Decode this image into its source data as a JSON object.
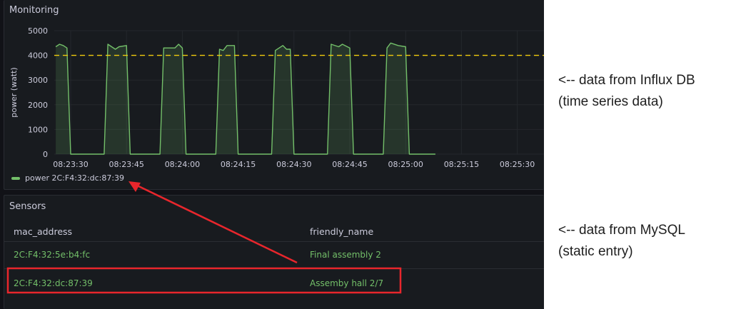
{
  "monitoring": {
    "title": "Monitoring",
    "legend_label": "power 2C:F4:32:dc:87:39"
  },
  "chart_data": {
    "type": "area",
    "title": "",
    "ylabel": "power (watt)",
    "xlabel": "",
    "ylim": [
      0,
      5000
    ],
    "y_ticks": [
      "0",
      "1000",
      "2000",
      "3000",
      "4000",
      "5000"
    ],
    "x_ticks": [
      "08:23:30",
      "08:23:45",
      "08:24:00",
      "08:24:15",
      "08:24:30",
      "08:24:45",
      "08:25:00",
      "08:25:15",
      "08:25:30"
    ],
    "threshold": 4000,
    "series": [
      {
        "name": "power 2C:F4:32:dc:87:39",
        "color": "#73bf69",
        "points": [
          [
            "08:23:26",
            4350
          ],
          [
            "08:23:27",
            4450
          ],
          [
            "08:23:28",
            4400
          ],
          [
            "08:23:29",
            4300
          ],
          [
            "08:23:30",
            0
          ],
          [
            "08:23:39",
            0
          ],
          [
            "08:23:40",
            4450
          ],
          [
            "08:23:42",
            4250
          ],
          [
            "08:23:43",
            4350
          ],
          [
            "08:23:45",
            4400
          ],
          [
            "08:23:46",
            0
          ],
          [
            "08:23:54",
            0
          ],
          [
            "08:23:55",
            4300
          ],
          [
            "08:23:58",
            4300
          ],
          [
            "08:23:59",
            4450
          ],
          [
            "08:24:00",
            4300
          ],
          [
            "08:24:01",
            0
          ],
          [
            "08:24:09",
            0
          ],
          [
            "08:24:10",
            4250
          ],
          [
            "08:24:11",
            4200
          ],
          [
            "08:24:12",
            4400
          ],
          [
            "08:24:14",
            4400
          ],
          [
            "08:24:15",
            0
          ],
          [
            "08:24:24",
            0
          ],
          [
            "08:24:25",
            4200
          ],
          [
            "08:24:27",
            4400
          ],
          [
            "08:24:28",
            4250
          ],
          [
            "08:24:29",
            4250
          ],
          [
            "08:24:30",
            0
          ],
          [
            "08:24:39",
            0
          ],
          [
            "08:24:40",
            4450
          ],
          [
            "08:24:42",
            4350
          ],
          [
            "08:24:43",
            4450
          ],
          [
            "08:24:45",
            4300
          ],
          [
            "08:24:46",
            0
          ],
          [
            "08:24:54",
            0
          ],
          [
            "08:24:55",
            4300
          ],
          [
            "08:24:56",
            4500
          ],
          [
            "08:24:58",
            4400
          ],
          [
            "08:25:00",
            4350
          ],
          [
            "08:25:01",
            0
          ],
          [
            "08:25:08",
            0
          ]
        ]
      }
    ]
  },
  "sensors": {
    "title": "Sensors",
    "columns": [
      "mac_address",
      "friendly_name"
    ],
    "rows": [
      {
        "mac_address": "2C:F4:32:5e:b4:fc",
        "friendly_name": "Final assembly 2"
      },
      {
        "mac_address": "2C:F4:32:dc:87:39",
        "friendly_name": "Assemby hall 2/7"
      }
    ]
  },
  "annotations": {
    "influx_line1": "<-- data from Influx DB",
    "influx_line2": "(time series data)",
    "mysql_line1": "<-- data from MySQL",
    "mysql_line2": "(static entry)",
    "highlight_color": "#e8262c"
  },
  "colors": {
    "series": "#73bf69",
    "threshold": "#f2cc0c",
    "background": "#111217",
    "panel": "#181b1f"
  }
}
